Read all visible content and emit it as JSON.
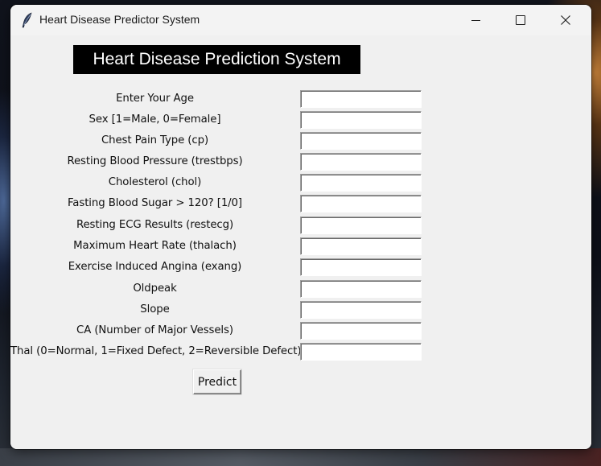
{
  "window": {
    "title": "Heart Disease Predictor System",
    "icon": "feather-icon",
    "controls": {
      "minimize": "minimize-icon",
      "maximize": "maximize-icon",
      "close": "close-icon"
    }
  },
  "app": {
    "heading": "Heart Disease Prediction System",
    "fields": [
      {
        "label": "Enter Your Age",
        "value": ""
      },
      {
        "label": "Sex [1=Male, 0=Female]",
        "value": ""
      },
      {
        "label": "Chest Pain Type (cp)",
        "value": ""
      },
      {
        "label": "Resting Blood Pressure (trestbps)",
        "value": ""
      },
      {
        "label": "Cholesterol (chol)",
        "value": ""
      },
      {
        "label": "Fasting Blood Sugar > 120? [1/0]",
        "value": ""
      },
      {
        "label": "Resting ECG Results (restecg)",
        "value": ""
      },
      {
        "label": "Maximum Heart Rate (thalach)",
        "value": ""
      },
      {
        "label": "Exercise Induced Angina (exang)",
        "value": ""
      },
      {
        "label": "Oldpeak",
        "value": ""
      },
      {
        "label": "Slope",
        "value": ""
      },
      {
        "label": "CA (Number of Major Vessels)",
        "value": ""
      },
      {
        "label": "Thal (0=Normal, 1=Fixed Defect, 2=Reversible Defect)",
        "value": ""
      }
    ],
    "predict_label": "Predict"
  },
  "colors": {
    "window_bg": "#f0f0f0",
    "heading_bg": "#000000",
    "heading_fg": "#ffffff"
  }
}
